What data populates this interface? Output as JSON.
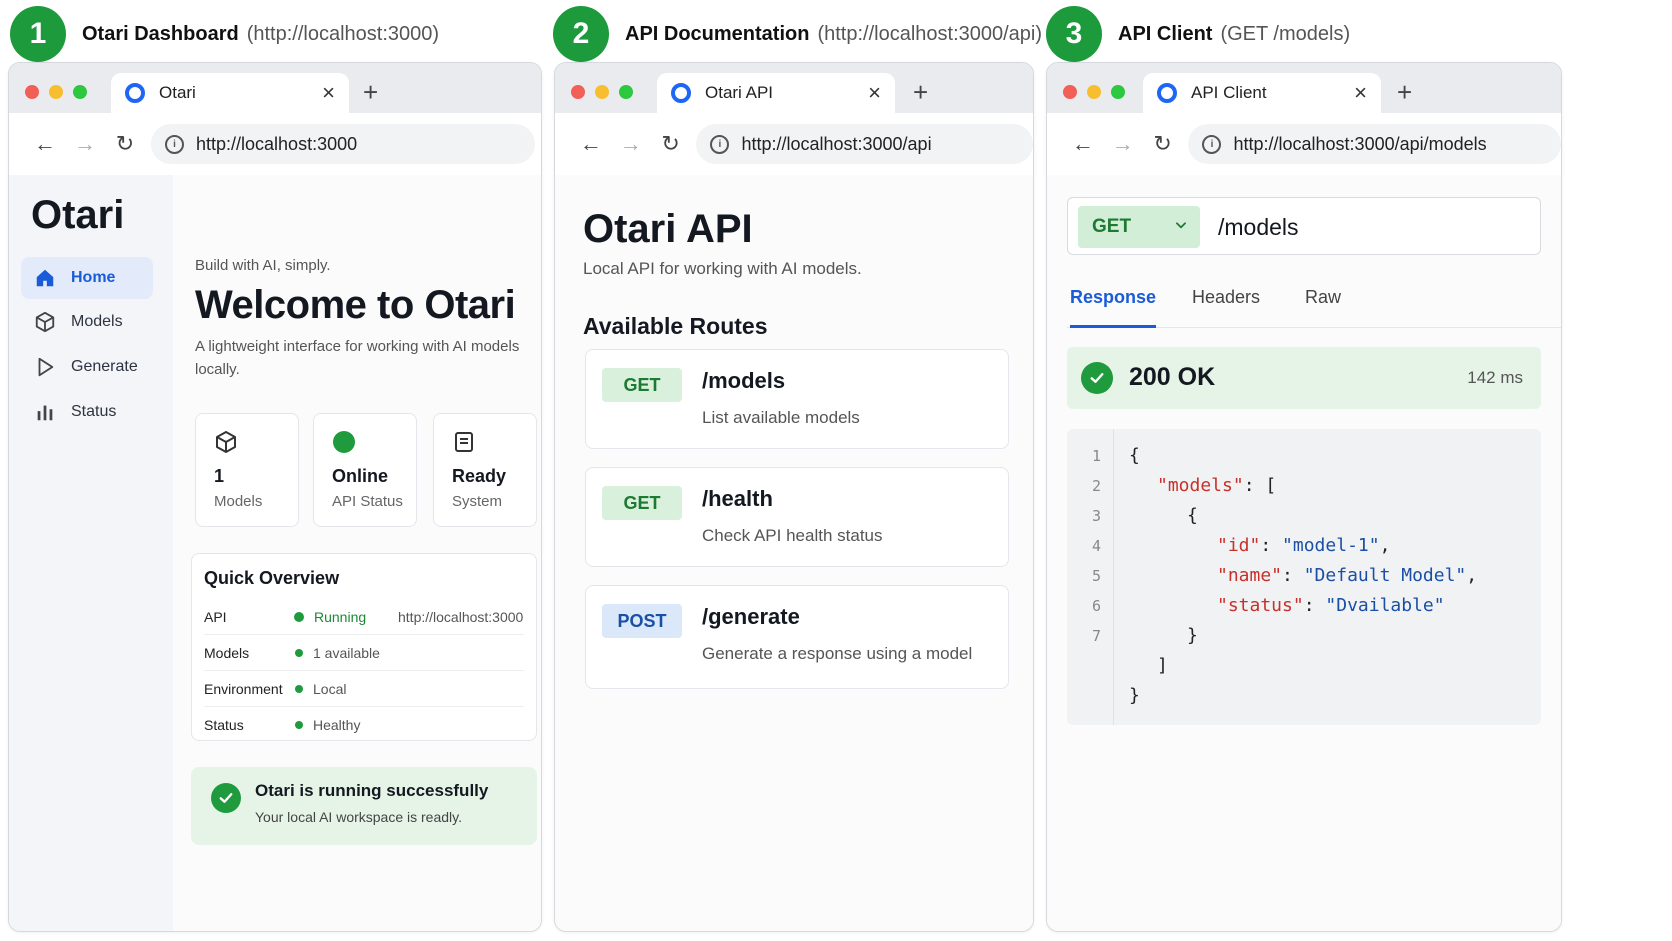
{
  "panels": [
    {
      "number": "1",
      "title": "Otari Dashboard",
      "subtitle": "(http://localhost:3000)"
    },
    {
      "number": "2",
      "title": "API Documentation",
      "subtitle": "(http://localhost:3000/api)"
    },
    {
      "number": "3",
      "title": "API Client",
      "subtitle": "(GET /models)"
    }
  ],
  "browsers": [
    {
      "tab_label": "Otari",
      "url": "http://localhost:3000"
    },
    {
      "tab_label": "Otari API",
      "url": "http://localhost:3000/api"
    },
    {
      "tab_label": "API Client",
      "url": "http://localhost:3000/api/models"
    }
  ],
  "dashboard": {
    "brand": "Otari",
    "sidebar": [
      {
        "label": "Home",
        "icon": "home-icon",
        "active": true
      },
      {
        "label": "Models",
        "icon": "cube-icon"
      },
      {
        "label": "Generate",
        "icon": "play-icon"
      },
      {
        "label": "Status",
        "icon": "bar-chart-icon"
      }
    ],
    "kicker": "Build with AI, simply.",
    "heading": "Welcome to Otari",
    "lede": "A lightweight interface for working with AI models locally.",
    "stats": [
      {
        "value": "1",
        "label": "Models",
        "icon": "cube-icon"
      },
      {
        "value": "Online",
        "label": "API Status",
        "icon": "status-dot-icon"
      },
      {
        "value": "Ready",
        "label": "System",
        "icon": "document-icon"
      }
    ],
    "overview": {
      "title": "Quick Overview",
      "rows": [
        {
          "key": "API",
          "value": "Running",
          "extra": "http://localhost:3000"
        },
        {
          "key": "Models",
          "value": "1 available",
          "extra": ""
        },
        {
          "key": "Environment",
          "value": "Local",
          "extra": ""
        },
        {
          "key": "Status",
          "value": "Healthy",
          "extra": ""
        }
      ]
    },
    "success": {
      "title": "Otari is running successfully",
      "subtitle": "Your local AI workspace is readly."
    }
  },
  "api_docs": {
    "title": "Otari API",
    "subtitle": "Local API for working with AI models.",
    "routes_title": "Available Routes",
    "routes": [
      {
        "method": "GET",
        "path": "/models",
        "desc": "List available models"
      },
      {
        "method": "GET",
        "path": "/health",
        "desc": "Check API health status"
      },
      {
        "method": "POST",
        "path": "/generate",
        "desc": "Generate a response using a model"
      }
    ]
  },
  "client": {
    "method": "GET",
    "path": "/models",
    "tabs": [
      "Response",
      "Headers",
      "Raw"
    ],
    "status": "200 OK",
    "time": "142 ms",
    "line_numbers": [
      "1",
      "2",
      "3",
      "4",
      "5",
      "6",
      "7"
    ],
    "code": {
      "l1": "{",
      "l2_key": "\"models\"",
      "l2_rest": ": [",
      "l3": "{",
      "l4_key": "\"id\"",
      "l4_colon": ": ",
      "l4_val": "\"model-1\"",
      "l4_comma": ",",
      "l5_key": "\"name\"",
      "l5_colon": ": ",
      "l5_val": "\"Default Model\"",
      "l5_comma": ",",
      "l6_key": "\"status\"",
      "l6_colon": ": ",
      "l6_val": "\"Dvailable\"",
      "l7": "}",
      "l8": "]",
      "l9": "}"
    }
  },
  "colors": {
    "accent": "#1a5bd8",
    "success": "#1f9a3d",
    "badge": "#1c9a3c"
  }
}
